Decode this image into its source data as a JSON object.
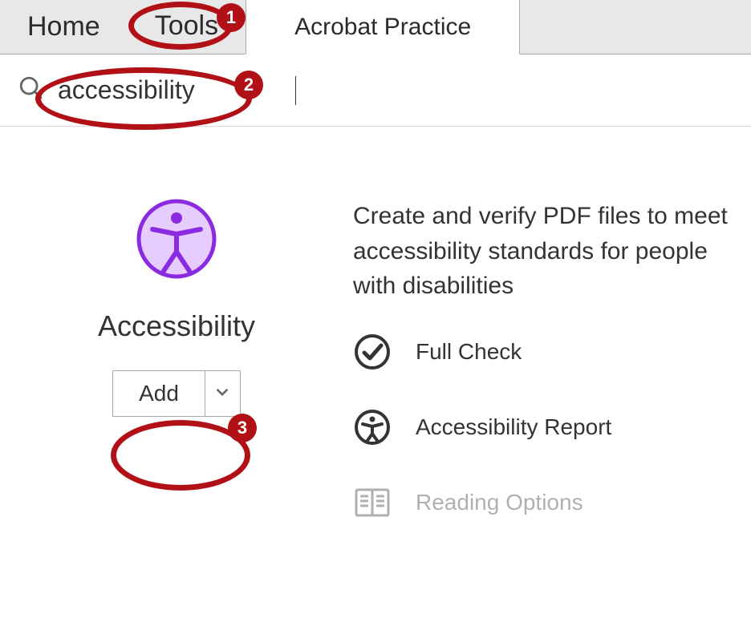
{
  "tabs": {
    "home": "Home",
    "tools": "Tools",
    "document": "Acrobat Practice"
  },
  "search": {
    "value": "accessibility"
  },
  "tool": {
    "name": "Accessibility",
    "add_label": "Add",
    "description": "Create and verify PDF files to meet accessibility standards for people with disabilities",
    "features": {
      "full_check": "Full Check",
      "report": "Accessibility Report",
      "reading_options": "Reading Options"
    }
  },
  "annotations": {
    "one": "1",
    "two": "2",
    "three": "3"
  }
}
